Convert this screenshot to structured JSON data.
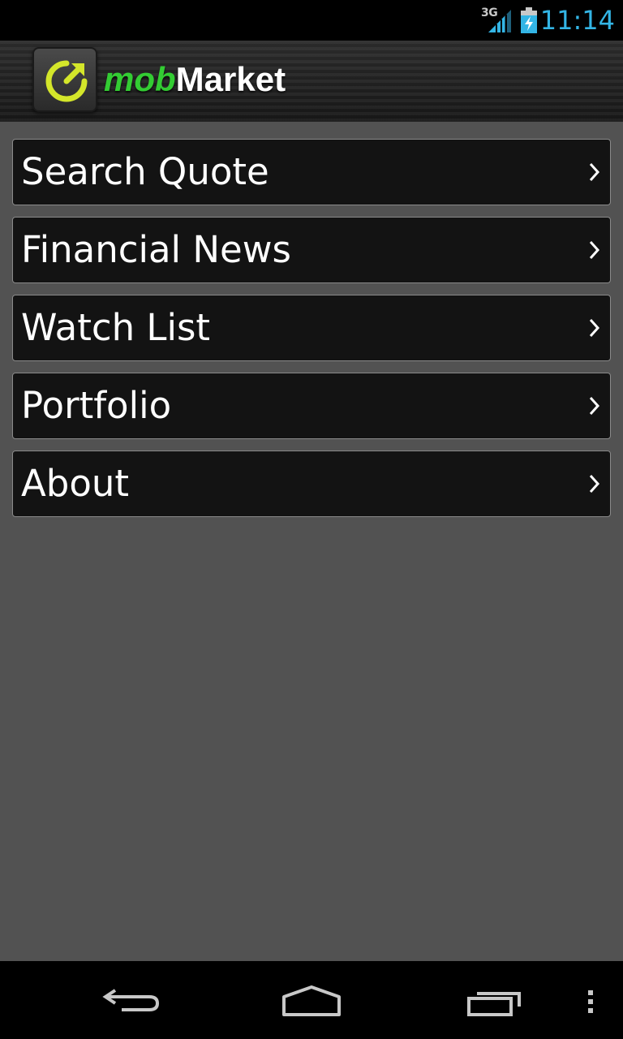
{
  "status_bar": {
    "network": "3G",
    "time": "11:14"
  },
  "header": {
    "title_prefix": "mob",
    "title_suffix": "Market"
  },
  "menu": {
    "items": [
      {
        "label": "Search Quote"
      },
      {
        "label": "Financial News"
      },
      {
        "label": "Watch List"
      },
      {
        "label": "Portfolio"
      },
      {
        "label": "About"
      }
    ]
  },
  "colors": {
    "background": "#525252",
    "accent_time": "#33b5e5",
    "logo_green": "#33cc33",
    "logo_ring": "#d4e62a"
  },
  "icons": {
    "app_logo": "refresh-arrow-icon",
    "signal": "signal-icon",
    "battery": "battery-charging-icon",
    "menu_chevron": "chevron-right-icon",
    "nav_back": "back-icon",
    "nav_home": "home-icon",
    "nav_recent": "recent-apps-icon",
    "nav_overflow": "overflow-menu-icon"
  }
}
